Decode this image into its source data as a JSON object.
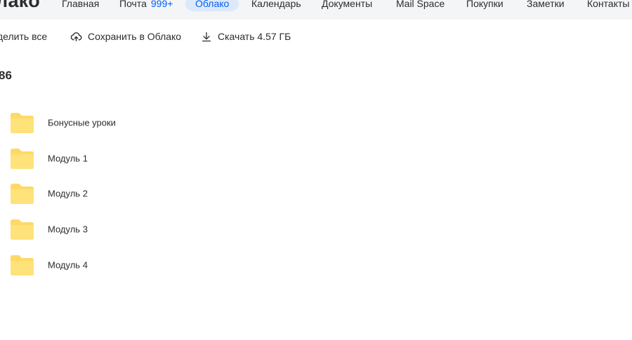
{
  "header": {
    "logo": "лако",
    "nav": [
      {
        "label": "Главная"
      },
      {
        "label": "Почта",
        "badge": "999+"
      },
      {
        "label": "Облако"
      },
      {
        "label": "Календарь"
      },
      {
        "label": "Документы"
      },
      {
        "label": "Mail Space"
      },
      {
        "label": "Покупки"
      },
      {
        "label": "Заметки"
      },
      {
        "label": "Контакты"
      }
    ]
  },
  "toolbar": {
    "select_all": "делить все",
    "save_to_cloud": "Сохранить в Облако",
    "download": "Скачать 4.57 ГБ"
  },
  "folder_count": "86",
  "folders": [
    {
      "name": "Бонусные уроки"
    },
    {
      "name": "Модуль 1"
    },
    {
      "name": "Модуль 2"
    },
    {
      "name": "Модуль 3"
    },
    {
      "name": "Модуль 4"
    }
  ],
  "colors": {
    "accent": "#005ff9",
    "folder": "#ffd966",
    "topbar_bg": "#f4f5f7"
  }
}
